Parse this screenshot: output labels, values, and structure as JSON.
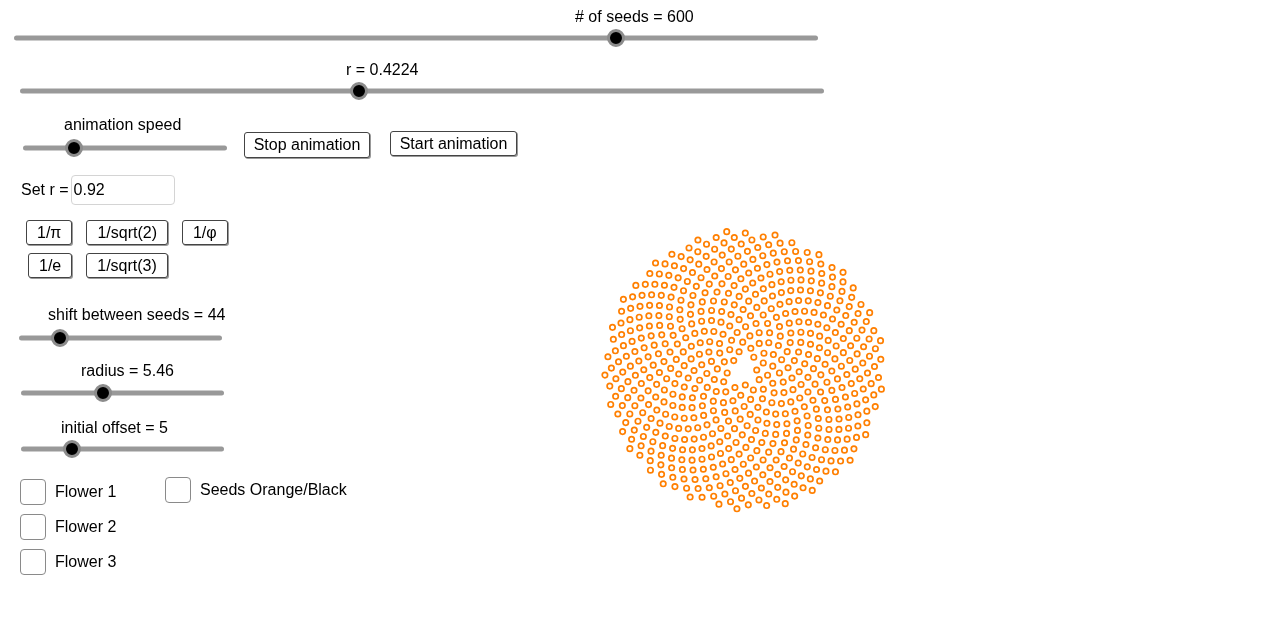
{
  "seeds_slider": {
    "label": "# of seeds = 600",
    "level": 0.749
  },
  "r_slider": {
    "label": "r = 0.4224",
    "level": 0.422
  },
  "animation_speed_slider": {
    "label": "animation speed",
    "level": 0.25
  },
  "animation_buttons": [
    {
      "label": "Stop animation"
    },
    {
      "label": "Start animation"
    }
  ],
  "set_r": {
    "label": "Set r =",
    "value": "0.92"
  },
  "constant_button_rows": [
    {
      "buttons": [
        "1/π",
        "1/sqrt(2)",
        "1/φ"
      ]
    },
    {
      "buttons": [
        "1/e",
        "1/sqrt(3)"
      ]
    }
  ],
  "parameter_sliders": [
    {
      "label": "shift between seeds = 44",
      "level": 0.2
    },
    {
      "label": "radius = 5.46",
      "level": 0.404
    },
    {
      "label": "initial offset = 5",
      "level": 0.25
    }
  ],
  "checkbox_columns": [
    {
      "items": [
        {
          "label": "Flower 1",
          "checked": false
        },
        {
          "label": "Flower 2",
          "checked": false
        },
        {
          "label": "Flower 3",
          "checked": false
        }
      ]
    },
    {
      "items": [
        {
          "label": "Seeds Orange/Black",
          "checked": false
        }
      ]
    }
  ]
}
